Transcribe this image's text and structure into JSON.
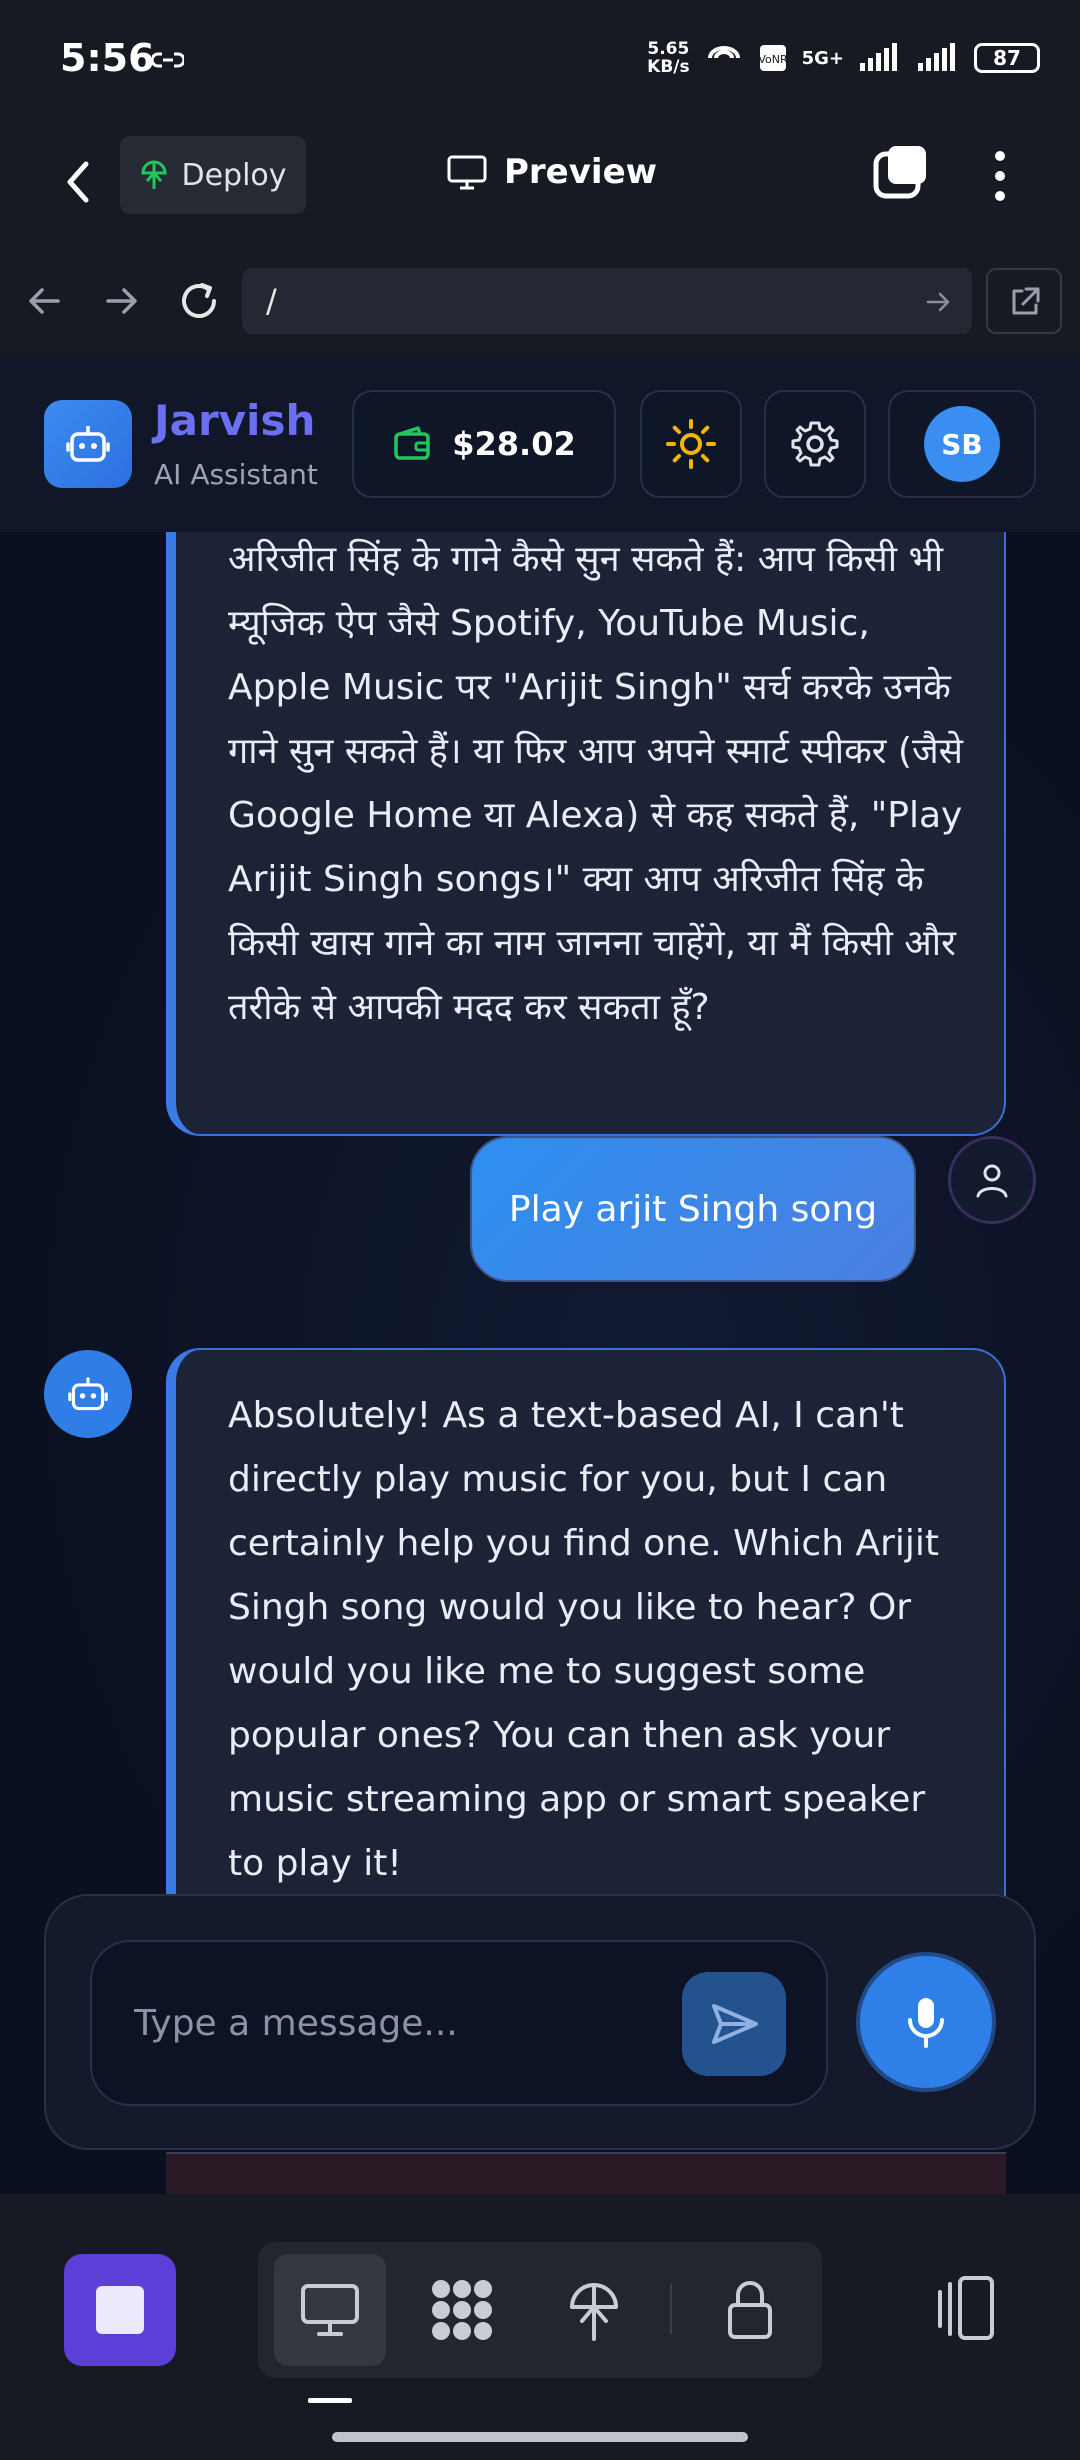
{
  "status_bar": {
    "time": "5:56",
    "net_speed_value": "5.65",
    "net_speed_unit": "KB/s",
    "network": "5G+",
    "battery": "87"
  },
  "app_bar": {
    "deploy_label": "Deploy",
    "title": "Preview"
  },
  "url_bar": {
    "url": "/"
  },
  "chat_header": {
    "brand_name": "Jarvish",
    "brand_subtitle": "AI Assistant",
    "balance": "$28.02",
    "avatar_initials": "SB"
  },
  "messages": [
    {
      "role": "assistant",
      "text": "अरिजीत सिंह के गाने कैसे सुन सकते हैं: आप किसी भी म्यूजिक ऐप जैसे Spotify, YouTube Music, Apple Music पर \"Arijit Singh\" सर्च करके उनके गाने सुन सकते हैं। या फिर आप अपने स्मार्ट स्पीकर (जैसे Google Home या Alexa) से कह सकते हैं, \"Play Arijit Singh songs।\" क्या आप अरिजीत सिंह के किसी खास गाने का नाम जानना चाहेंगे, या मैं किसी और तरीके से आपकी मदद कर सकता हूँ?"
    },
    {
      "role": "user",
      "text": "Play arjit Singh song"
    },
    {
      "role": "assistant",
      "text": "Absolutely! As a text-based AI, I can't directly play music for you, but I can certainly help you find one. Which Arijit Singh song would you like to hear? Or would you like me to suggest some popular ones? You can then ask your music streaming app or smart speaker to play it!"
    }
  ],
  "composer": {
    "placeholder": "Type a message..."
  },
  "colors": {
    "accent_blue": "#3b7be8",
    "brand_purple": "#6b6ff2",
    "stop_purple": "#5b3fd6",
    "wallet_green": "#22c55e",
    "sun_yellow": "#f5b400"
  },
  "icons": [
    "back-icon",
    "deploy-icon",
    "monitor-icon",
    "pages-icon",
    "more-icon",
    "arrow-left-icon",
    "arrow-right-icon",
    "reload-icon",
    "open-external-icon",
    "bot-icon",
    "wallet-icon",
    "sun-icon",
    "gear-icon",
    "user-icon",
    "send-icon",
    "mic-icon",
    "stop-icon",
    "desktop-icon",
    "grid-icon",
    "deploy-nav-icon",
    "lock-icon",
    "rotate-icon"
  ]
}
